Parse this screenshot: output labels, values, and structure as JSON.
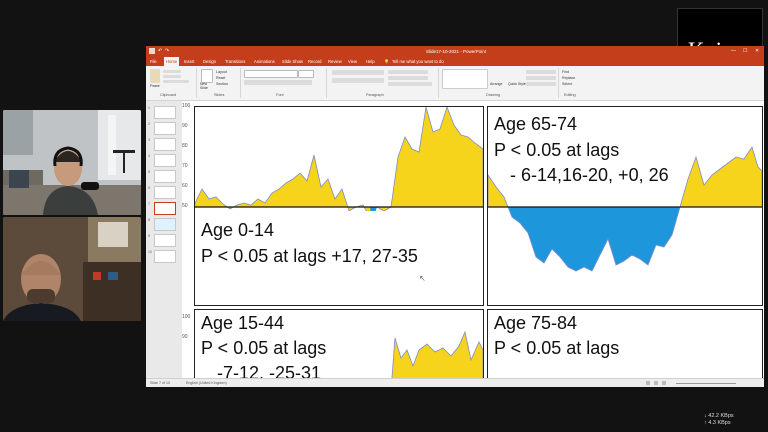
{
  "logo": {
    "text": "Kairos"
  },
  "app": {
    "title": "Slide17-10-2021 - PowerPoint",
    "tabs": [
      "File",
      "Home",
      "Insert",
      "Design",
      "Transitions",
      "Animations",
      "Slide Show",
      "Record",
      "Review",
      "View",
      "Help"
    ],
    "active_tab": "Home",
    "tell_me": "Tell me what you want to do",
    "ribbon_groups": [
      "Clipboard",
      "Slides",
      "Font",
      "Paragraph",
      "Drawing",
      "Editing"
    ],
    "ribbon_buttons": {
      "paste": "Paste",
      "new_slide": "New Slide",
      "layout": "Layout",
      "reset": "Reset",
      "section": "Section",
      "arrange": "Arrange",
      "quick_styles": "Quick Styles",
      "find": "Find",
      "replace": "Replace",
      "select": "Select"
    },
    "slide_numbers": [
      "1",
      "2",
      "3",
      "4",
      "5",
      "6",
      "7",
      "8",
      "9",
      "10"
    ],
    "status": {
      "slide": "Slide 7 of 10",
      "language": "English (United Kingdom)"
    }
  },
  "panels": [
    {
      "title": "Age 0-14",
      "subtitle": "P < 0.05 at lags +17, 27-35",
      "subtitle2": ""
    },
    {
      "title": "Age 65-74",
      "subtitle": "P < 0.05 at lags",
      "subtitle2": "- 6-14,16-20, +0, 26"
    },
    {
      "title": "Age 15-44",
      "subtitle": "P < 0.05 at lags",
      "subtitle2": "-7-12, -25-31"
    },
    {
      "title": "Age 75-84",
      "subtitle": "P < 0.05 at lags",
      "subtitle2": ""
    }
  ],
  "axis_ticks": [
    "100",
    "90",
    "80",
    "70",
    "60",
    "50"
  ],
  "axis_ticks_bottom": [
    "100",
    "90"
  ],
  "colors": {
    "positive": "#f6d41b",
    "negative": "#1e96dc",
    "powerpoint": "#c43e1c",
    "line": "#7d8cc8"
  },
  "network": {
    "down": "↓ 42.2 KBps",
    "up": "↑ 4.3 KBps"
  }
}
